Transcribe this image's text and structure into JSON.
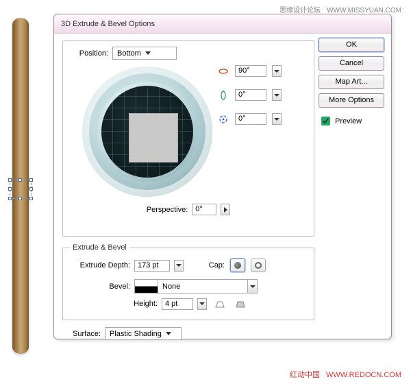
{
  "watermark_top": {
    "text": "思缘设计论坛",
    "url": "WWW.MISSYUAN.COM"
  },
  "watermark_bottom": {
    "text": "红动中国",
    "url": "WWW.REDOCN.COM"
  },
  "dialog": {
    "title": "3D Extrude & Bevel Options",
    "buttons": {
      "ok": "OK",
      "cancel": "Cancel",
      "map_art": "Map Art...",
      "more_options": "More Options"
    },
    "preview": {
      "label": "Preview",
      "checked": true
    },
    "position": {
      "label": "Position:",
      "value": "Bottom",
      "x": {
        "value": "90°"
      },
      "y": {
        "value": "0°"
      },
      "z": {
        "value": "0°"
      },
      "perspective": {
        "label": "Perspective:",
        "value": "0°"
      }
    },
    "extrude": {
      "legend": "Extrude & Bevel",
      "depth": {
        "label": "Extrude Depth:",
        "value": "173 pt"
      },
      "cap": {
        "label": "Cap:"
      },
      "bevel": {
        "label": "Bevel:",
        "value": "None"
      },
      "height": {
        "label": "Height:",
        "value": "4 pt"
      }
    },
    "surface": {
      "label": "Surface:",
      "value": "Plastic Shading"
    }
  }
}
